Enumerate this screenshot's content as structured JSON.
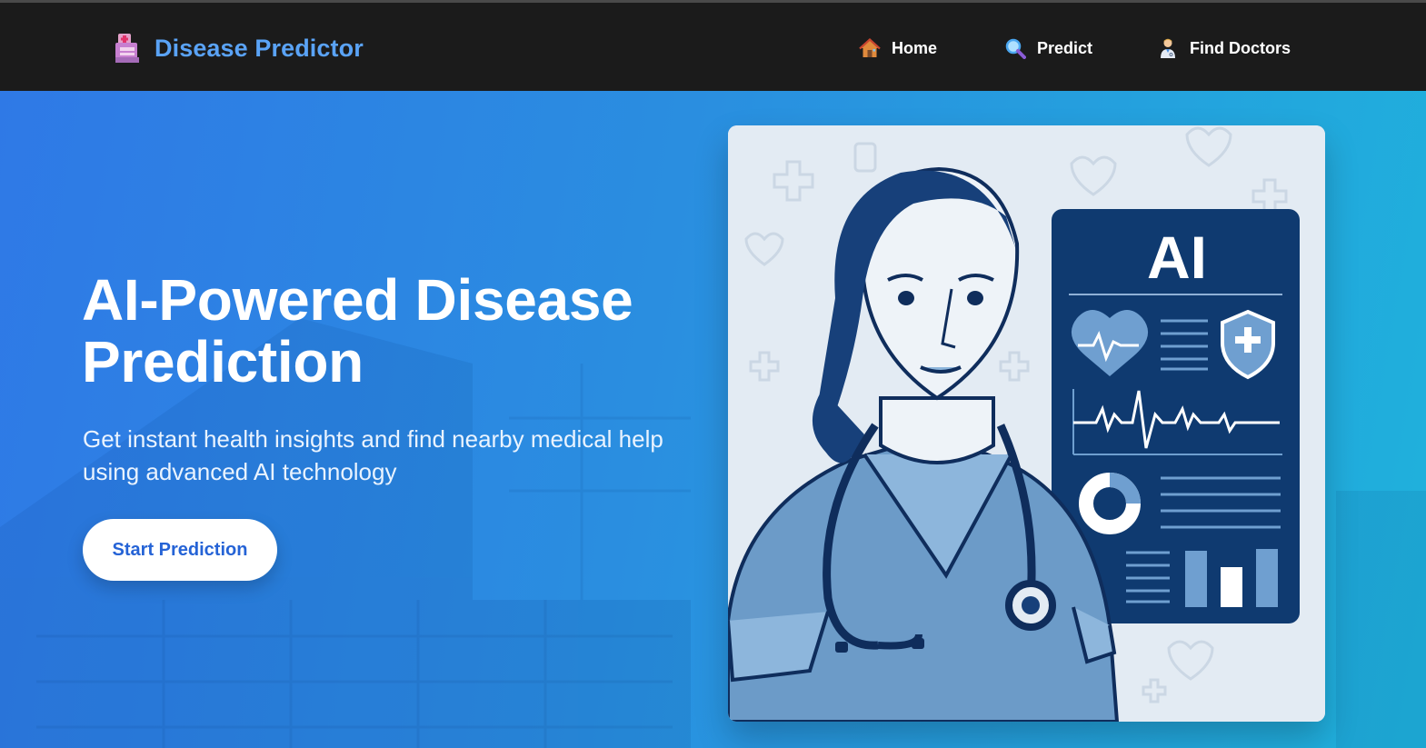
{
  "app": {
    "brand_name": "Disease Predictor",
    "brand_icon": "hospital-icon"
  },
  "nav": {
    "items": [
      {
        "label": "Home",
        "icon": "house-icon"
      },
      {
        "label": "Predict",
        "icon": "magnifier-icon"
      },
      {
        "label": "Find Doctors",
        "icon": "doctor-icon"
      }
    ]
  },
  "hero": {
    "title": "AI-Powered Disease Prediction",
    "subtitle": "Get instant health insights and find nearby medical help using advanced AI technology",
    "cta_label": "Start Prediction",
    "illustration": {
      "panel_heading": "AI",
      "icons": [
        "heart-monitor-icon",
        "shield-plus-icon",
        "donut-chart-icon",
        "bar-chart-icon",
        "stethoscope-icon"
      ]
    }
  },
  "colors": {
    "navbar_bg": "#1b1b1b",
    "brand": "#5aa3f6",
    "hero_gradient_start": "#2f79e6",
    "hero_gradient_end": "#1fb2dc",
    "cta_text": "#2563d6",
    "panel_navy": "#0f3a70"
  }
}
